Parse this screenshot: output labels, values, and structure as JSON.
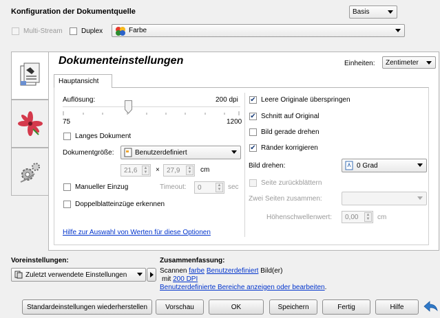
{
  "header": {
    "title": "Konfiguration der Dokumentquelle",
    "mode_value": "Basis",
    "multistream_label": "Multi-Stream",
    "duplex_label": "Duplex",
    "color_value": "Farbe"
  },
  "panel": {
    "title": "Dokumenteinstellungen",
    "units_label": "Einheiten:",
    "units_value": "Zentimeter",
    "tab_main": "Hauptansicht"
  },
  "left": {
    "resolution_label": "Auflösung:",
    "resolution_value": "200 dpi",
    "slider_min": "75",
    "slider_max": "1200",
    "long_doc_label": "Langes Dokument",
    "doc_size_label": "Dokumentgröße:",
    "doc_size_value": "Benutzerdefiniert",
    "width_value": "21,6",
    "times": "×",
    "height_value": "27,9",
    "size_unit": "cm",
    "manual_feed_label": "Manueller Einzug",
    "timeout_label": "Timeout:",
    "timeout_value": "0",
    "timeout_unit": "sec",
    "double_feed_label": "Doppelblatteinzüge erkennen",
    "help_link": "Hilfe zur Auswahl von Werten für diese Optionen"
  },
  "right": {
    "skip_blank_label": "Leere Originale überspringen",
    "crop_label": "Schnitt auf Original",
    "straighten_label": "Bild gerade drehen",
    "edges_label": "Ränder korrigieren",
    "rotate_label": "Bild drehen:",
    "rotate_value": "0 Grad",
    "flip_label": "Seite zurückblättern",
    "merge_label": "Zwei Seiten zusammen:",
    "merge_value": "",
    "height_threshold_label": "Höhenschwellenwert:",
    "height_threshold_value": "0,00",
    "height_threshold_unit": "cm"
  },
  "presets": {
    "label": "Voreinstellungen:",
    "value": "Zuletzt verwendete Einstellungen"
  },
  "summary": {
    "label": "Zusammenfassung:",
    "line1_pre": "Scannen ",
    "line1_link1": "farbe",
    "line1_space": " ",
    "line1_link2": "Benutzerdefiniert",
    "line1_post": " Bild(er)",
    "line2_pre": "mit ",
    "line2_link": "200 DPI",
    "line3_link": "Benutzerdefinierte Bereiche anzeigen oder bearbeiten",
    "line3_post": "."
  },
  "buttons": {
    "restore": "Standardeinstellungen wiederherstellen",
    "preview": "Vorschau",
    "ok": "OK",
    "save": "Speichern",
    "done": "Fertig",
    "help": "Hilfe"
  },
  "colors": {
    "accent_blue": "#2f79c8",
    "link": "#0033cc"
  },
  "icons": {
    "checked_mark": "✔",
    "back": "back-arrow-icon"
  }
}
